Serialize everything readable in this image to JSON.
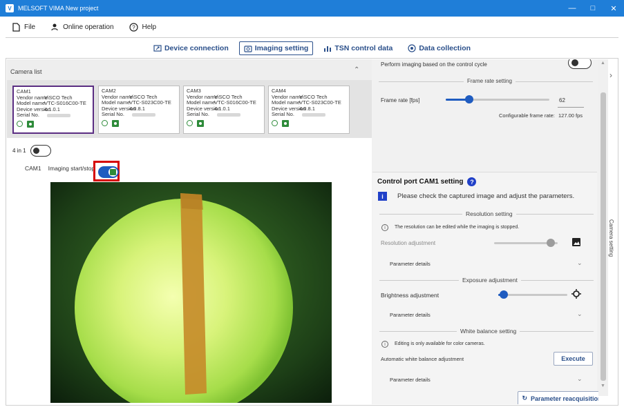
{
  "window": {
    "title": "MELSOFT VIMA New project",
    "logo": "V"
  },
  "menu": {
    "file": "File",
    "online": "Online operation",
    "help": "Help"
  },
  "tabs": {
    "device_connection": "Device connection",
    "imaging_setting": "Imaging setting",
    "tsn_control_data": "TSN control data",
    "data_collection": "Data collection"
  },
  "camera_list": {
    "title": "Camera list",
    "field_labels": {
      "vendor": "Vendor name",
      "model": "Model name",
      "device_version": "Device version",
      "serial": "Serial No."
    },
    "cameras": [
      {
        "name": "CAM1",
        "vendor": "ViSCO Tech",
        "model": "VTC-S016C00-TE",
        "device_version": "4.1.0.1"
      },
      {
        "name": "CAM2",
        "vendor": "ViSCO Tech",
        "model": "VTC-S023C00-TE",
        "device_version": "4.0.8.1"
      },
      {
        "name": "CAM3",
        "vendor": "ViSCO Tech",
        "model": "VTC-S016C00-TE",
        "device_version": "4.1.0.1"
      },
      {
        "name": "CAM4",
        "vendor": "ViSCO Tech",
        "model": "VTC-S023C00-TE",
        "device_version": "4.0.8.1"
      }
    ]
  },
  "four_in_one": {
    "label": "4 in 1",
    "on": false
  },
  "imaging": {
    "camera": "CAM1",
    "label": "Imaging start/stop",
    "on": true
  },
  "right_panel": {
    "perform_imaging_label": "Perform imaging based on the control cycle",
    "frame_rate_section": "Frame rate setting",
    "frame_rate_label": "Frame rate [fps]",
    "frame_rate_value": "62",
    "configurable_label": "Configurable frame rate:",
    "configurable_value": "127.00 fps",
    "control_port_title": "Control port CAM1 setting",
    "info_message": "Please check the captured image and adjust the parameters.",
    "resolution_section": "Resolution setting",
    "resolution_note": "The resolution can be edited while the imaging is stopped.",
    "resolution_adjustment": "Resolution adjustment",
    "parameter_details": "Parameter details",
    "exposure_section": "Exposure adjustment",
    "brightness_adjustment": "Brightness adjustment",
    "white_balance_section": "White balance setting",
    "white_balance_note": "Editing is only available for color cameras.",
    "auto_white_balance": "Automatic white balance adjustment",
    "execute": "Execute",
    "parameter_reacquisition": "Parameter reacquisition"
  },
  "side_tab": {
    "label": "Camera setting"
  },
  "colors": {
    "accent": "#1f5cc0",
    "title_bar": "#1f7ed8",
    "highlight": "#d60000",
    "camera_green": "#2e8b3a"
  }
}
